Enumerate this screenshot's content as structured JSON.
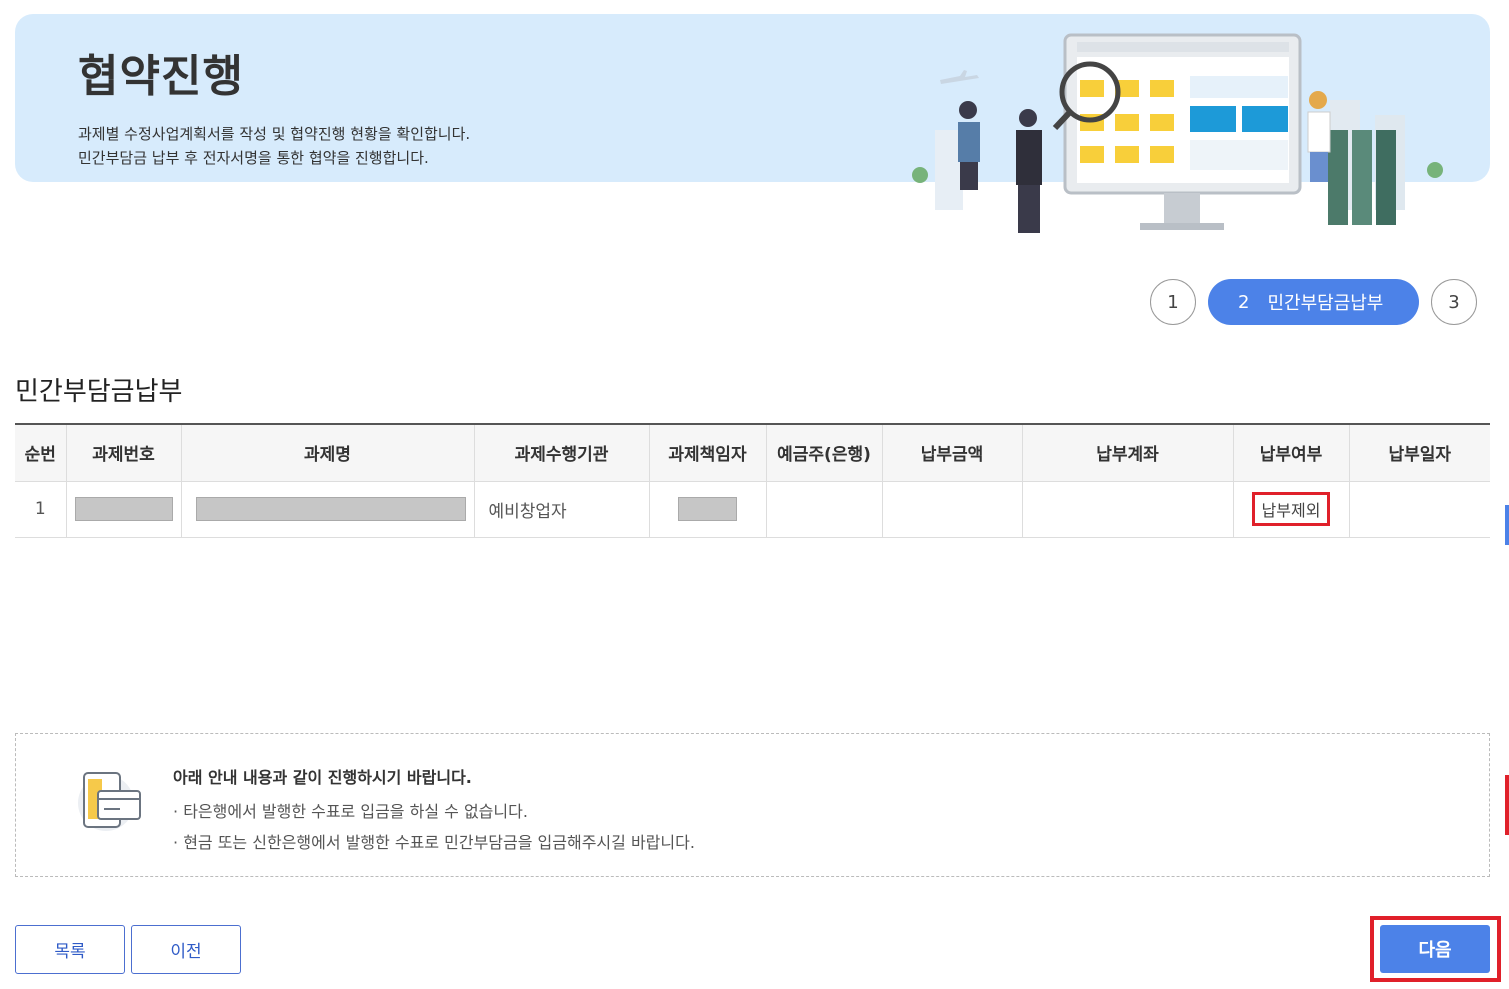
{
  "banner": {
    "title": "협약진행",
    "desc_line1": "과제별 수정사업계획서를 작성 및 협약진행 현황을 확인합니다.",
    "desc_line2": "민간부담금 납부 후 전자서명을 통한 협약을 진행합니다."
  },
  "stepper": {
    "step1": "1",
    "step2_num": "2",
    "step2_label": "민간부담금납부",
    "step3": "3",
    "active_color": "#4c82e8"
  },
  "section_title": "민간부담금납부",
  "table": {
    "headers": [
      "순번",
      "과제번호",
      "과제명",
      "과제수행기관",
      "과제책임자",
      "예금주(은행)",
      "납부금액",
      "납부계좌",
      "납부여부",
      "납부일자"
    ],
    "rows": [
      {
        "seq": "1",
        "org": "예비창업자",
        "status": "납부제외"
      }
    ]
  },
  "notice": {
    "heading": "아래 안내 내용과 같이 진행하시기 바랍니다.",
    "item1": "타은행에서 발행한 수표로 입금을 하실 수 없습니다.",
    "item2": "현금 또는 신한은행에서 발행한 수표로 민간부담금을 입금해주시길 바랍니다.",
    "bullet": "·"
  },
  "buttons": {
    "list": "목록",
    "prev": "이전",
    "next": "다음"
  },
  "colors": {
    "primary": "#4c82e8",
    "highlight": "#e0202a",
    "banner_bg": "#d7ebfc"
  }
}
